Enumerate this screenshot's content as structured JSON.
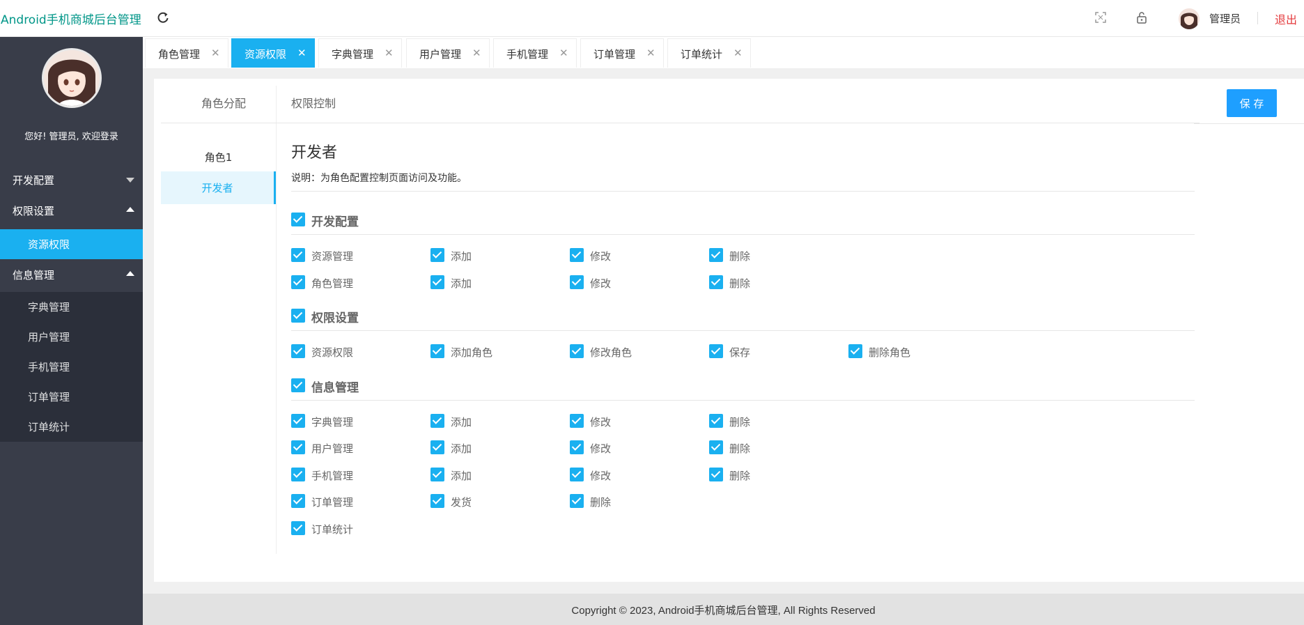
{
  "header": {
    "brand": "Android手机商城后台管理",
    "admin_name": "管理员",
    "logout": "退出",
    "icons": [
      "refresh-icon",
      "fullscreen-icon",
      "lock-icon"
    ]
  },
  "sidebar": {
    "welcome": "您好! 管理员, 欢迎登录",
    "groups": [
      {
        "label": "开发配置",
        "expanded": false
      },
      {
        "label": "权限设置",
        "expanded": true,
        "items": [
          "资源权限"
        ]
      },
      {
        "label": "信息管理",
        "expanded": true,
        "items": [
          "字典管理",
          "用户管理",
          "手机管理",
          "订单管理",
          "订单统计"
        ]
      }
    ],
    "active_item": "资源权限"
  },
  "tabs": [
    {
      "label": "角色管理",
      "active": false
    },
    {
      "label": "资源权限",
      "active": true
    },
    {
      "label": "字典管理",
      "active": false
    },
    {
      "label": "用户管理",
      "active": false
    },
    {
      "label": "手机管理",
      "active": false
    },
    {
      "label": "订单管理",
      "active": false
    },
    {
      "label": "订单统计",
      "active": false
    }
  ],
  "panel": {
    "left_title": "角色分配",
    "right_title": "权限控制",
    "save_label": "保 存",
    "roles": [
      "角色1",
      "开发者"
    ],
    "selected_role": "开发者",
    "role_title": "开发者",
    "description": "说明：为角色配置控制页面访问及功能。",
    "permission_groups": [
      {
        "label": "开发配置",
        "checked": true,
        "rows": [
          [
            "资源管理",
            "添加",
            "修改",
            "删除"
          ],
          [
            "角色管理",
            "添加",
            "修改",
            "删除"
          ]
        ]
      },
      {
        "label": "权限设置",
        "checked": true,
        "rows": [
          [
            "资源权限",
            "添加角色",
            "修改角色",
            "保存",
            "删除角色"
          ]
        ]
      },
      {
        "label": "信息管理",
        "checked": true,
        "rows": [
          [
            "字典管理",
            "添加",
            "修改",
            "删除"
          ],
          [
            "用户管理",
            "添加",
            "修改",
            "删除"
          ],
          [
            "手机管理",
            "添加",
            "修改",
            "删除"
          ],
          [
            "订单管理",
            "发货",
            "删除"
          ],
          [
            "订单统计"
          ]
        ]
      }
    ]
  },
  "footer": "Copyright © 2023, Android手机商城后台管理, All Rights Reserved",
  "colors": {
    "accent": "#1ab0f0",
    "brand": "#009688",
    "sidebar": "#393d49",
    "logout": "#e4393c",
    "save": "#1e9fff"
  }
}
